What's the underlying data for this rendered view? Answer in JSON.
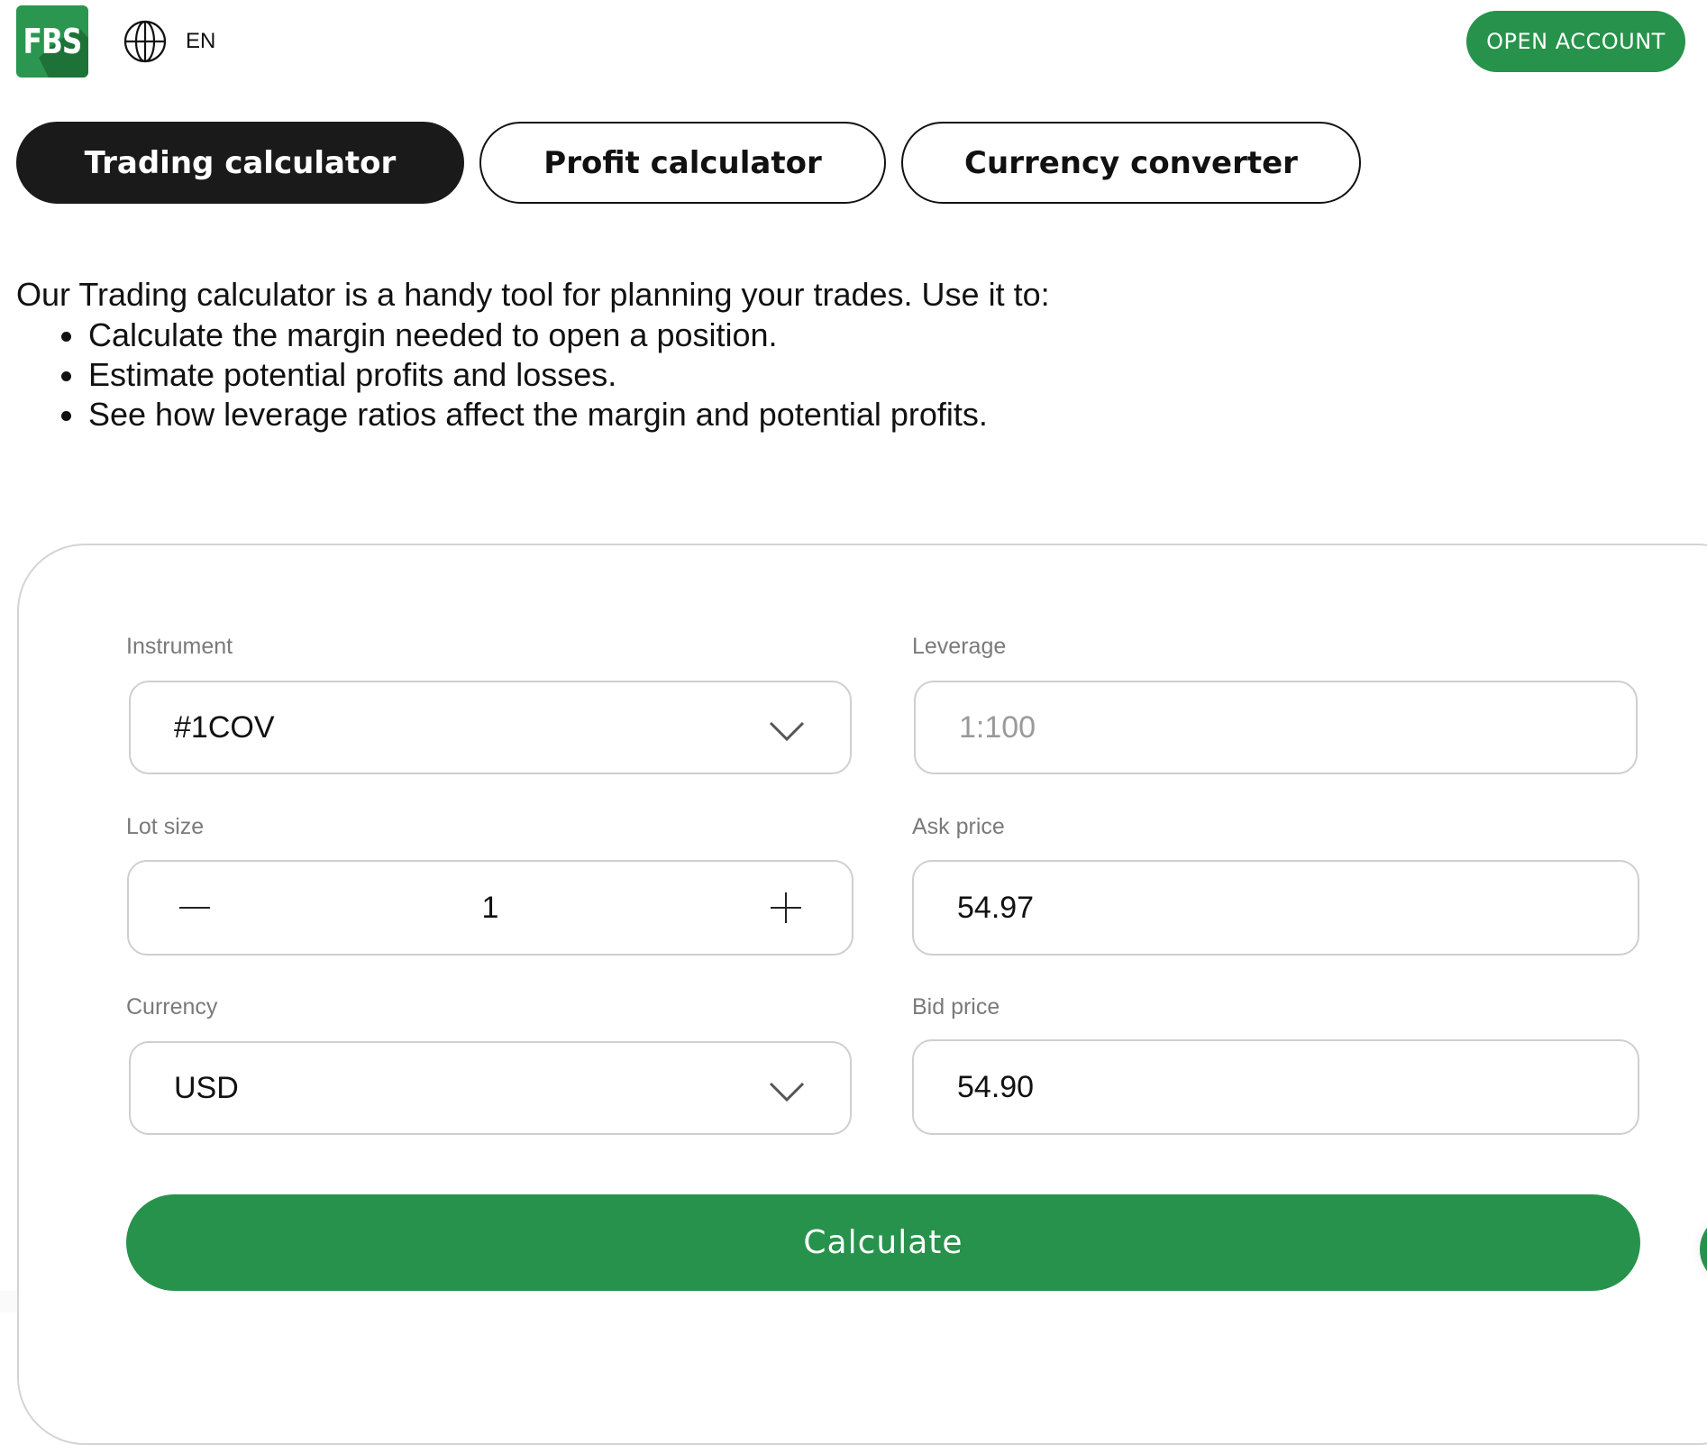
{
  "header": {
    "logo_text": "FBS",
    "language": "EN",
    "open_account_label": "OPEN ACCOUNT"
  },
  "tabs": [
    {
      "label": "Trading calculator",
      "active": true
    },
    {
      "label": "Profit calculator",
      "active": false
    },
    {
      "label": "Currency converter",
      "active": false
    }
  ],
  "intro": {
    "text": "Our Trading calculator is a handy tool for planning your trades. Use it to:",
    "bullets": [
      "Calculate the margin needed to open a position.",
      "Estimate potential profits and losses.",
      "See how leverage ratios affect the margin and potential profits."
    ]
  },
  "form": {
    "instrument": {
      "label": "Instrument",
      "value": "#1COV"
    },
    "leverage": {
      "label": "Leverage",
      "value": "1:100"
    },
    "lot_size": {
      "label": "Lot size",
      "value": "1"
    },
    "ask_price": {
      "label": "Ask price",
      "value": "54.97"
    },
    "currency": {
      "label": "Currency",
      "value": "USD"
    },
    "bid_price": {
      "label": "Bid price",
      "value": "54.90"
    },
    "calculate_label": "Calculate"
  },
  "colors": {
    "brand_green": "#27924b",
    "active_tab": "#1a1a1a"
  }
}
